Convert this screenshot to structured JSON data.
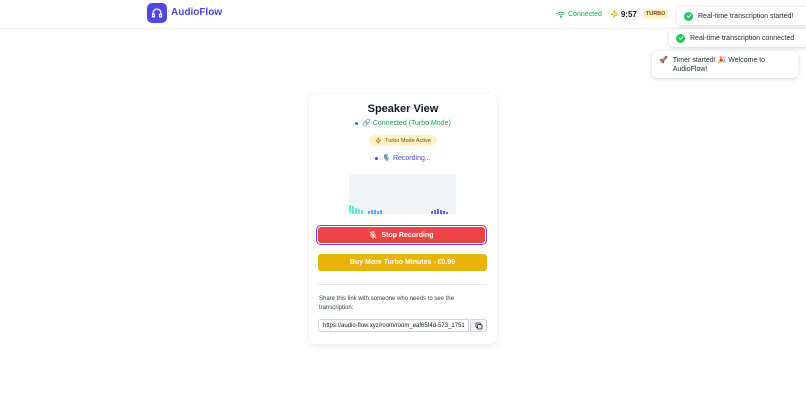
{
  "header": {
    "brand": "AudioFlow",
    "connection_status": "Connected",
    "timer": "9:57",
    "turbo_badge": "TURBO"
  },
  "toasts": [
    {
      "text": "Real-time transcription started!",
      "icon": "check-circle-icon"
    },
    {
      "text": "Real-time transcription connected",
      "icon": "check-circle-icon"
    },
    {
      "text_line1": "Timer started! 🎉 Welcome to",
      "text_line2": "AudioFlow!",
      "icon": "rocket-icon"
    }
  ],
  "card": {
    "title": "Speaker View",
    "connection_status": "🔗 Connected (Turbo Mode)",
    "turbo_status": "Turbo Mode Active",
    "recording_status": "🎙️ Recording...",
    "stop_button": "Stop Recording",
    "buy_button": "Buy More Turbo Minutes - £0.99",
    "share_text": "Share this link with someone who needs to see the transcription:",
    "share_link": "https://audio-flow.xyz/room/room_eaf65f4d-573_1751"
  },
  "colors": {
    "brand": "#4f46e5",
    "connected": "#16a34a",
    "turbo_bg": "#fef3c7",
    "stop": "#ef4444",
    "buy": "#eab308",
    "recording": "#4f46e5",
    "toast_check": "#22c55e"
  }
}
